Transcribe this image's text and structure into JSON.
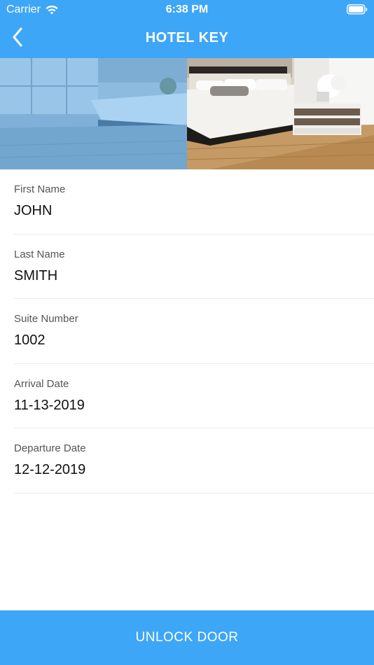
{
  "status_bar": {
    "carrier": "Carrier",
    "time": "6:38 PM",
    "icons": [
      "wifi-icon",
      "battery-icon"
    ]
  },
  "nav": {
    "title": "HOTEL KEY",
    "back_icon": "chevron-left-icon"
  },
  "hero": {
    "image": "hotel-room-photo"
  },
  "fields": [
    {
      "label": "First Name",
      "value": "JOHN"
    },
    {
      "label": "Last Name",
      "value": "SMITH"
    },
    {
      "label": "Suite Number",
      "value": "1002"
    },
    {
      "label": "Arrival Date",
      "value": "11-13-2019"
    },
    {
      "label": "Departure Date",
      "value": "12-12-2019"
    }
  ],
  "actions": {
    "unlock_label": "UNLOCK DOOR"
  },
  "colors": {
    "primary": "#3ea6f7",
    "text": "#111111",
    "label": "#555555",
    "divider": "#ececec"
  }
}
